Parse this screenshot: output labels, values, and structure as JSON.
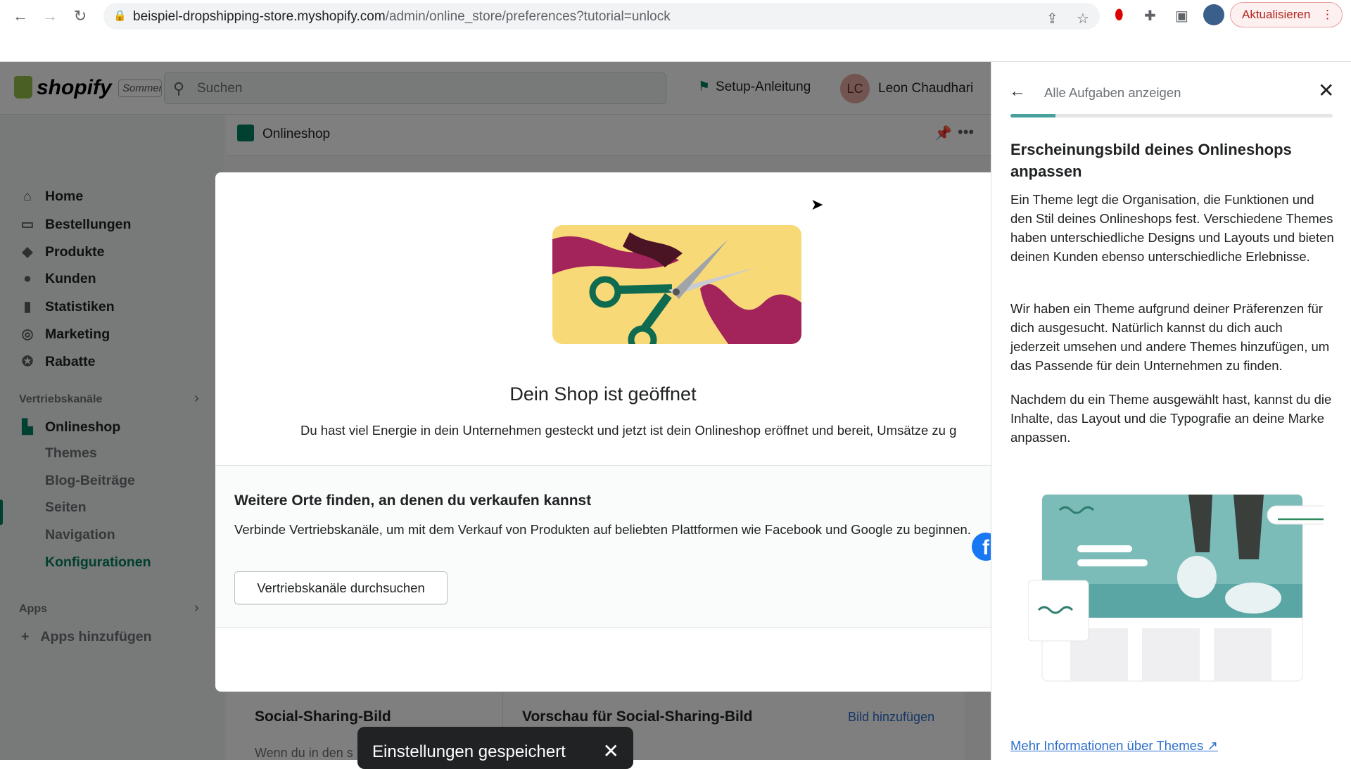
{
  "browser": {
    "url_host": "beispiel-dropshipping-store.myshopify.com",
    "url_path": "/admin/online_store/preferences?tutorial=unlock",
    "update_label": "Aktualisieren"
  },
  "header": {
    "logo": "shopify",
    "store_badge": "Sommer",
    "search_placeholder": "Suchen",
    "setup_label": "Setup-Anleitung",
    "avatar_initials": "LC",
    "user_name": "Leon Chaudhari"
  },
  "sidebar": {
    "items": [
      {
        "label": "Home",
        "icon": "home-icon"
      },
      {
        "label": "Bestellungen",
        "icon": "inbox-icon"
      },
      {
        "label": "Produkte",
        "icon": "tag-icon"
      },
      {
        "label": "Kunden",
        "icon": "person-icon"
      },
      {
        "label": "Statistiken",
        "icon": "bar-chart-icon"
      },
      {
        "label": "Marketing",
        "icon": "target-icon"
      },
      {
        "label": "Rabatte",
        "icon": "discount-icon"
      }
    ],
    "channels_heading": "Vertriebskanäle",
    "onlineshop": "Onlineshop",
    "subitems": [
      "Themes",
      "Blog-Beiträge",
      "Seiten",
      "Navigation",
      "Konfigurationen"
    ],
    "active_subitem": "Konfigurationen",
    "apps_heading": "Apps",
    "add_apps": "Apps hinzufügen"
  },
  "page": {
    "title": "Onlineshop",
    "social_title": "Social-Sharing-Bild",
    "social_preview": "Vorschau für Social-Sharing-Bild",
    "add_image": "Bild hinzufügen",
    "social_desc": "Wenn du in den s"
  },
  "modal": {
    "title": "Dein Shop ist geöffnet",
    "text": "Du hast viel Energie in dein Unternehmen gesteckt und jetzt ist dein Onlineshop eröffnet und bereit, Umsätze zu g",
    "section_title": "Weitere Orte finden, an denen du verkaufen kannst",
    "section_desc": "Verbinde Vertriebskanäle, um mit dem Verkauf von Produkten auf beliebten Plattformen wie Facebook und Google zu beginnen.",
    "button": "Vertriebskanäle durchsuchen"
  },
  "toast": {
    "text": "Einstellungen gespeichert"
  },
  "panel": {
    "back_label": "Alle Aufgaben anzeigen",
    "progress_percent": 14,
    "title": "Erscheinungsbild deines Onlineshops anpassen",
    "paragraphs": [
      "Ein Theme legt die Organisation, die Funktionen und den Stil deines Onlineshops fest. Verschiedene Themes haben unterschiedliche Designs und Layouts und bieten deinen Kunden ebenso unterschiedliche Erlebnisse.",
      "Wir haben ein Theme aufgrund deiner Präferenzen für dich ausgesucht. Natürlich kannst du dich auch jederzeit umsehen und andere Themes hinzufügen, um das Passende für dein Unternehmen zu finden.",
      "Nachdem du ein Theme ausgewählt hast, kannst du die Inhalte, das Layout und die Typografie an deine Marke anpassen."
    ],
    "link": "Mehr Informationen über Themes"
  },
  "colors": {
    "accent": "#008060",
    "link": "#2c6ecb",
    "progress": "#47a09b"
  }
}
